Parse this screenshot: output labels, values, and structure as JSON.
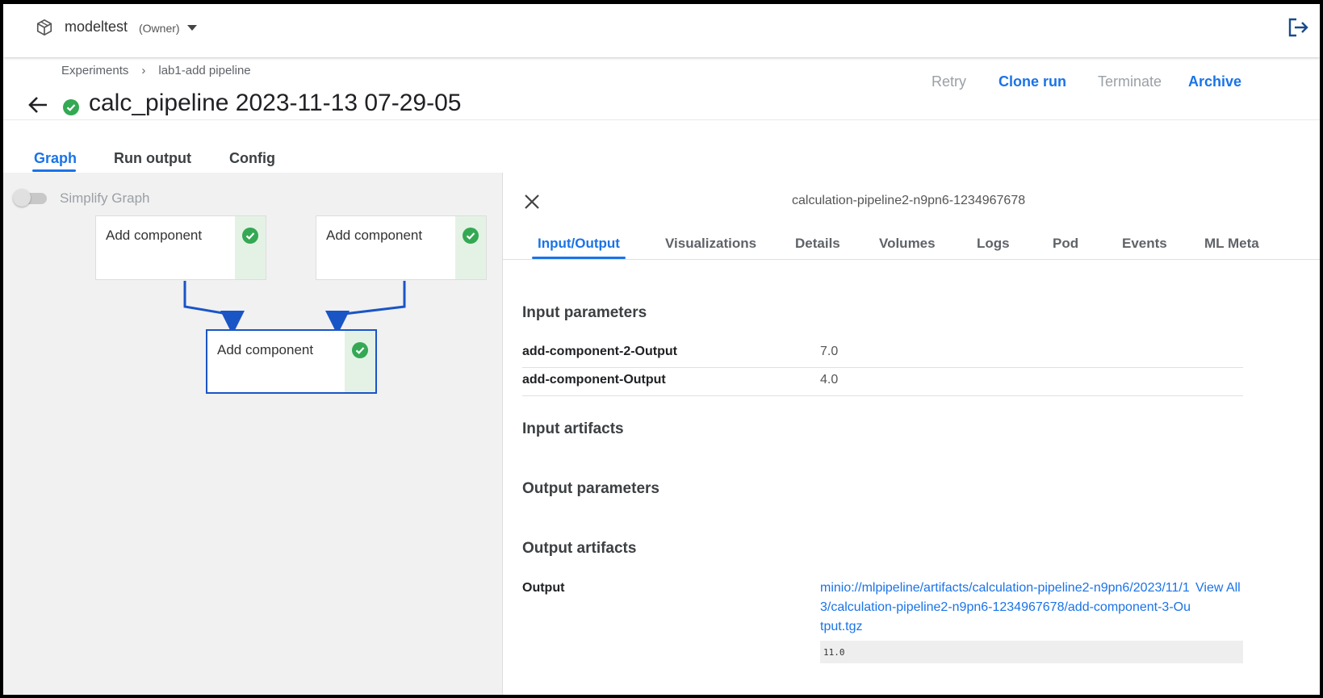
{
  "topbar": {
    "namespace": "modeltest",
    "role": "(Owner)",
    "icons": {
      "namespace": "cube-icon",
      "menu": "caret-down-icon",
      "logout": "logout-icon"
    }
  },
  "breadcrumb": [
    "Experiments",
    "lab1-add pipeline"
  ],
  "run": {
    "title": "calc_pipeline 2023-11-13 07-29-05",
    "status": "succeeded",
    "actions": {
      "retry": "Retry",
      "clone": "Clone run",
      "terminate": "Terminate",
      "archive": "Archive"
    }
  },
  "tabs": [
    "Graph",
    "Run output",
    "Config"
  ],
  "graph": {
    "simplify_label": "Simplify Graph",
    "nodes": [
      {
        "label": "Add component",
        "status": "succeeded"
      },
      {
        "label": "Add component",
        "status": "succeeded"
      },
      {
        "label": "Add component",
        "status": "succeeded",
        "selected": true
      }
    ]
  },
  "side_panel": {
    "pod_name": "calculation-pipeline2-n9pn6-1234967678",
    "tabs": [
      "Input/Output",
      "Visualizations",
      "Details",
      "Volumes",
      "Logs",
      "Pod",
      "Events",
      "ML Meta"
    ],
    "active_tab": "Input/Output",
    "sections": {
      "input_parameters": "Input parameters",
      "input_artifacts": "Input artifacts",
      "output_parameters": "Output parameters",
      "output_artifacts": "Output artifacts"
    },
    "input_parameters": [
      {
        "key": "add-component-2-Output",
        "value": "7.0"
      },
      {
        "key": "add-component-Output",
        "value": "4.0"
      }
    ],
    "output_artifacts": [
      {
        "key": "Output",
        "uri": "minio://mlpipeline/artifacts/calculation-pipeline2-n9pn6/2023/11/13/calculation-pipeline2-n9pn6-1234967678/add-component-3-Output.tgz",
        "view_all": "View All",
        "preview": "11.0"
      }
    ]
  },
  "colors": {
    "accent": "#1a73e8",
    "success": "#34a853",
    "graph_bg": "#f1f1f1"
  }
}
